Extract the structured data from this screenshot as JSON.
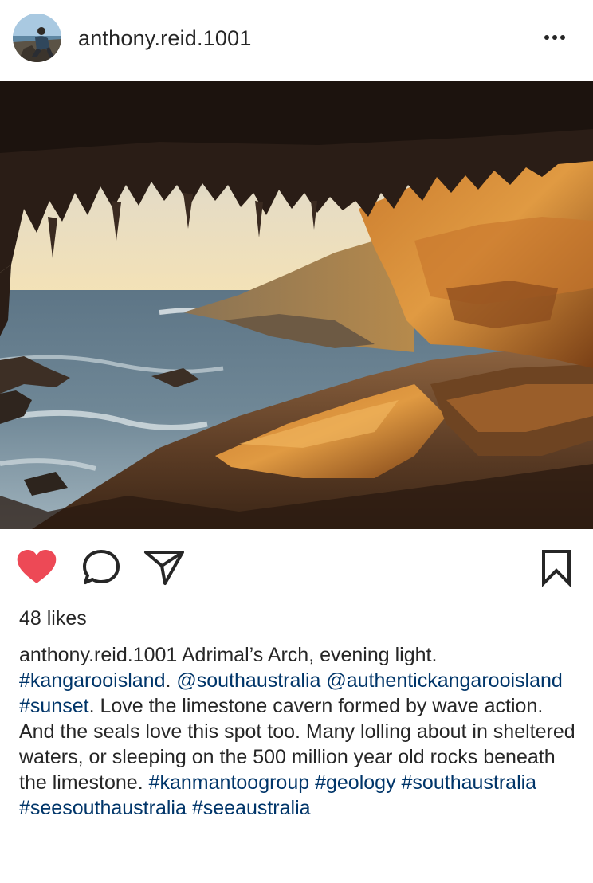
{
  "post": {
    "username": "anthony.reid.1001",
    "more_icon": "more-horizontal-icon",
    "likes": "48 likes",
    "caption": {
      "username": "anthony.reid.1001",
      "line1_text": " Adrimal’s Arch, evening light.",
      "tag1": "#kangarooisland",
      "sep1": ". ",
      "tag2": "@southaustralia",
      "tag3": "@authentickangarooisland",
      "sep2": " ",
      "tag4": "#sunset",
      "body": ". Love the limestone cavern formed by wave action. And the seals love this spot too. Many lolling about in sheltered waters, or sleeping on the 500 million year old rocks beneath the limestone. ",
      "tag5": "#kanmantoogroup",
      "tag6": "#geology",
      "tag7": "#southaustralia",
      "tag8": "#seesouthaustralia",
      "tag9": "#seeaustralia"
    },
    "icons": {
      "like": "heart-filled-icon",
      "comment": "comment-icon",
      "share": "send-icon",
      "save": "bookmark-icon"
    },
    "colors": {
      "like_red": "#ed4956",
      "tag_blue": "#003569",
      "text": "#262626"
    }
  }
}
